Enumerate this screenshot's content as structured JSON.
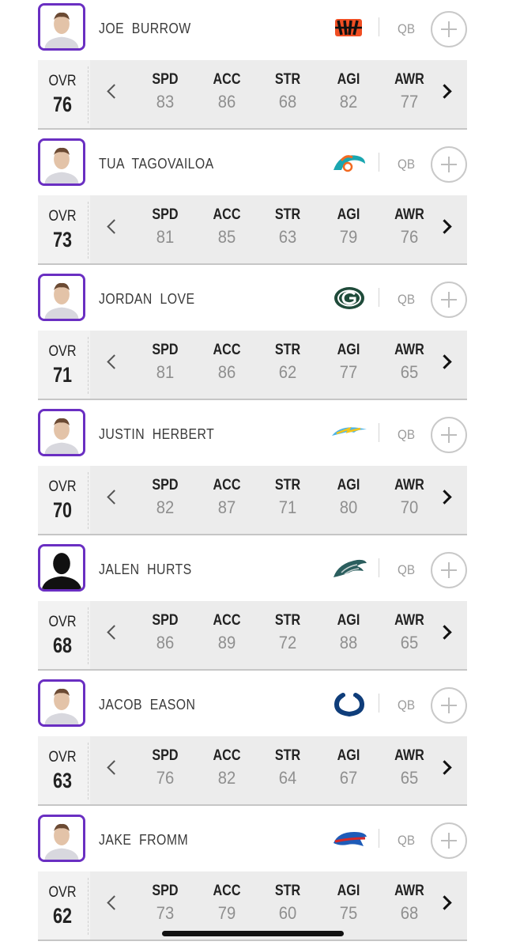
{
  "stat_labels": [
    "SPD",
    "ACC",
    "STR",
    "AGI",
    "AWR"
  ],
  "ovr_label": "OVR",
  "colors": {
    "accent": "#6a2fc2",
    "stat_bg": "#ececec",
    "text": "#222222",
    "muted": "#8f8f8f"
  },
  "players": [
    {
      "name": "JOE  BURROW",
      "position": "QB",
      "team_logo": "bengals-logo",
      "ovr": "76",
      "stats": [
        "83",
        "86",
        "68",
        "82",
        "77"
      ],
      "avatar": "player-photo"
    },
    {
      "name": "TUA  TAGOVAILOA",
      "position": "QB",
      "team_logo": "dolphins-logo",
      "ovr": "73",
      "stats": [
        "81",
        "85",
        "63",
        "79",
        "76"
      ],
      "avatar": "player-photo"
    },
    {
      "name": "JORDAN  LOVE",
      "position": "QB",
      "team_logo": "packers-logo",
      "ovr": "71",
      "stats": [
        "81",
        "86",
        "62",
        "77",
        "65"
      ],
      "avatar": "player-photo"
    },
    {
      "name": "JUSTIN  HERBERT",
      "position": "QB",
      "team_logo": "chargers-logo",
      "ovr": "70",
      "stats": [
        "82",
        "87",
        "71",
        "80",
        "70"
      ],
      "avatar": "player-photo"
    },
    {
      "name": "JALEN  HURTS",
      "position": "QB",
      "team_logo": "eagles-logo",
      "ovr": "68",
      "stats": [
        "86",
        "89",
        "72",
        "88",
        "65"
      ],
      "avatar": "silhouette"
    },
    {
      "name": "JACOB  EASON",
      "position": "QB",
      "team_logo": "colts-logo",
      "ovr": "63",
      "stats": [
        "76",
        "82",
        "64",
        "67",
        "65"
      ],
      "avatar": "player-photo"
    },
    {
      "name": "JAKE  FROMM",
      "position": "QB",
      "team_logo": "bills-logo",
      "ovr": "62",
      "stats": [
        "73",
        "79",
        "60",
        "75",
        "68"
      ],
      "avatar": "player-photo"
    }
  ]
}
